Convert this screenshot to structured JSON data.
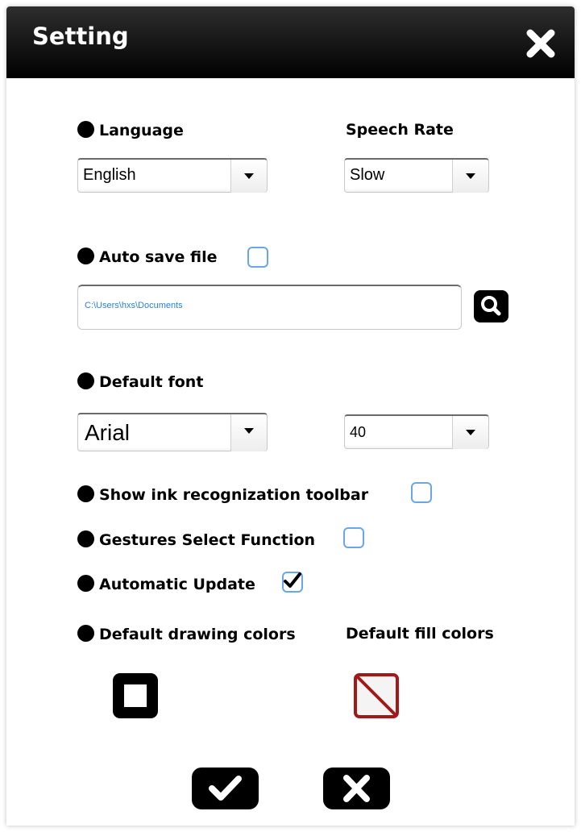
{
  "window": {
    "title": "Setting",
    "close_icon": "close-icon"
  },
  "language": {
    "label": "Language",
    "value": "English"
  },
  "speech_rate": {
    "label": "Speech Rate",
    "value": "Slow"
  },
  "auto_save": {
    "label": "Auto save file",
    "checked": false,
    "path": "C:\\Users\\hxs\\Documents"
  },
  "default_font": {
    "label": "Default font",
    "family": "Arial",
    "size": "40"
  },
  "options": {
    "ink_toolbar": {
      "label": "Show ink recognization toolbar",
      "checked": false
    },
    "gestures": {
      "label": "Gestures Select Function",
      "checked": false
    },
    "auto_update": {
      "label": "Automatic Update",
      "checked": true
    }
  },
  "colors": {
    "drawing_label": "Default drawing colors",
    "fill_label": "Default fill colors",
    "drawing_color": "#000000",
    "fill_color": "none",
    "accent_red": "#a11a1a",
    "checkbox_border": "#6aa7e6"
  },
  "actions": {
    "ok_icon": "checkmark-icon",
    "cancel_icon": "x-icon"
  }
}
